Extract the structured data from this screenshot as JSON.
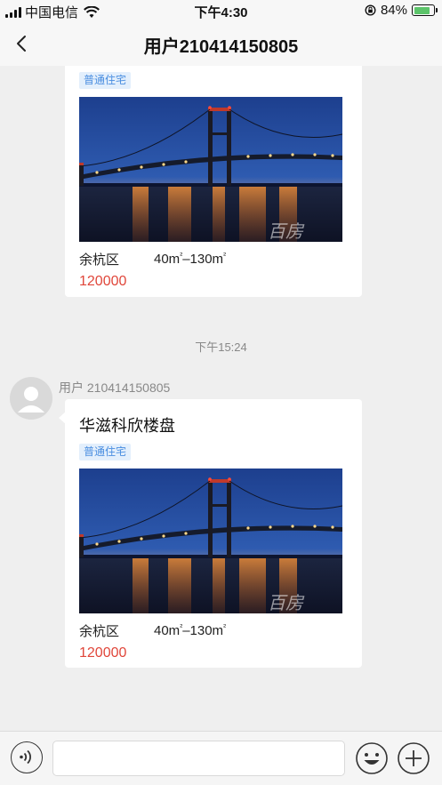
{
  "status_bar": {
    "carrier": "中国电信",
    "time": "下午4:30",
    "battery_percent": "84%",
    "battery_level": 0.84,
    "icons": [
      "signal-icon",
      "wifi-icon",
      "orientation-lock-icon",
      "battery-icon"
    ]
  },
  "nav": {
    "title": "用户210414150805",
    "back_icon": "chevron-left-icon"
  },
  "messages": {
    "top_card": {
      "tag": "普通住宅",
      "district": "余杭区",
      "area_from": "40m",
      "area_to": "–130m",
      "area_sup": "²",
      "price": "120000"
    },
    "timestamp": "下午15:24",
    "sender": "用户 210414150805",
    "bottom_card": {
      "title": "华滋科欣楼盘",
      "tag": "普通住宅",
      "district": "余杭区",
      "area_from": "40m",
      "area_to": "–130m",
      "area_sup": "²",
      "price": "120000"
    },
    "photo_watermark": "百房"
  },
  "input_bar": {
    "placeholder": "",
    "icons": [
      "voice-icon",
      "emoji-icon",
      "plus-icon"
    ]
  },
  "colors": {
    "price": "#e0463a",
    "tag_bg": "#e3effc",
    "tag_text": "#4a8ee0",
    "background": "#efefef"
  }
}
